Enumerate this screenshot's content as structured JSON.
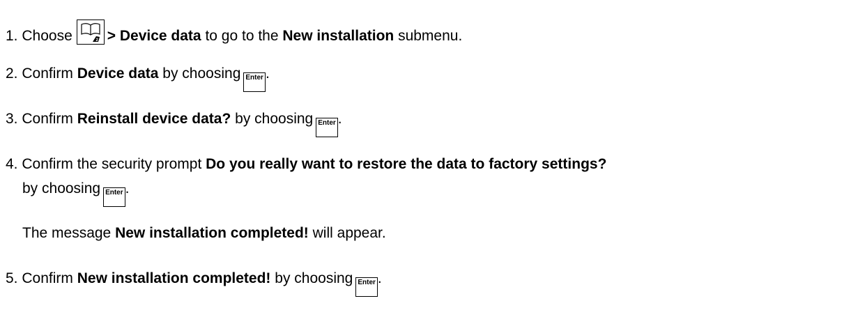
{
  "steps": [
    {
      "number": "1.",
      "pre": "Choose",
      "icon": "manual-book-icon",
      "bold1": "> Device data",
      "mid": "to go to the",
      "bold2": "New installation",
      "post": "submenu."
    },
    {
      "number": "2.",
      "pre": "Confirm",
      "bold1": "Device data",
      "post": "by choosing",
      "key_label": "Enter",
      "end": "."
    },
    {
      "number": "3.",
      "pre": "Confirm",
      "bold1": "Reinstall device data?",
      "post": "by choosing",
      "key_label": "Enter",
      "end": "."
    },
    {
      "number": "4.",
      "pre": "Confirm the security prompt",
      "bold1": "Do you really want to restore the data to factory settings?",
      "cont": "by choosing",
      "key_label": "Enter",
      "end": ".",
      "result_pre": "The message",
      "result_bold": "New installation completed!",
      "result_post": "will appear."
    },
    {
      "number": "5.",
      "pre": "Confirm",
      "bold1": "New installation completed!",
      "post": "by choosing",
      "key_label": "Enter",
      "end": "."
    }
  ]
}
